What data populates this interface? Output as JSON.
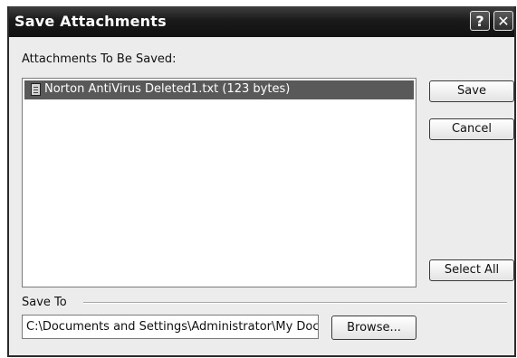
{
  "window": {
    "title": "Save Attachments",
    "help_label": "?",
    "close_label": "✕"
  },
  "attachments": {
    "label": "Attachments To Be Saved:",
    "items": [
      {
        "name": "Norton AntiVirus Deleted1.txt (123 bytes)",
        "icon": "text-file-icon",
        "selected": true
      }
    ]
  },
  "buttons": {
    "save": "Save",
    "cancel": "Cancel",
    "select_all": "Select All",
    "browse": "Browse..."
  },
  "save_to": {
    "label": "Save To",
    "value": "C:\\Documents and Settings\\Administrator\\My Docur"
  }
}
